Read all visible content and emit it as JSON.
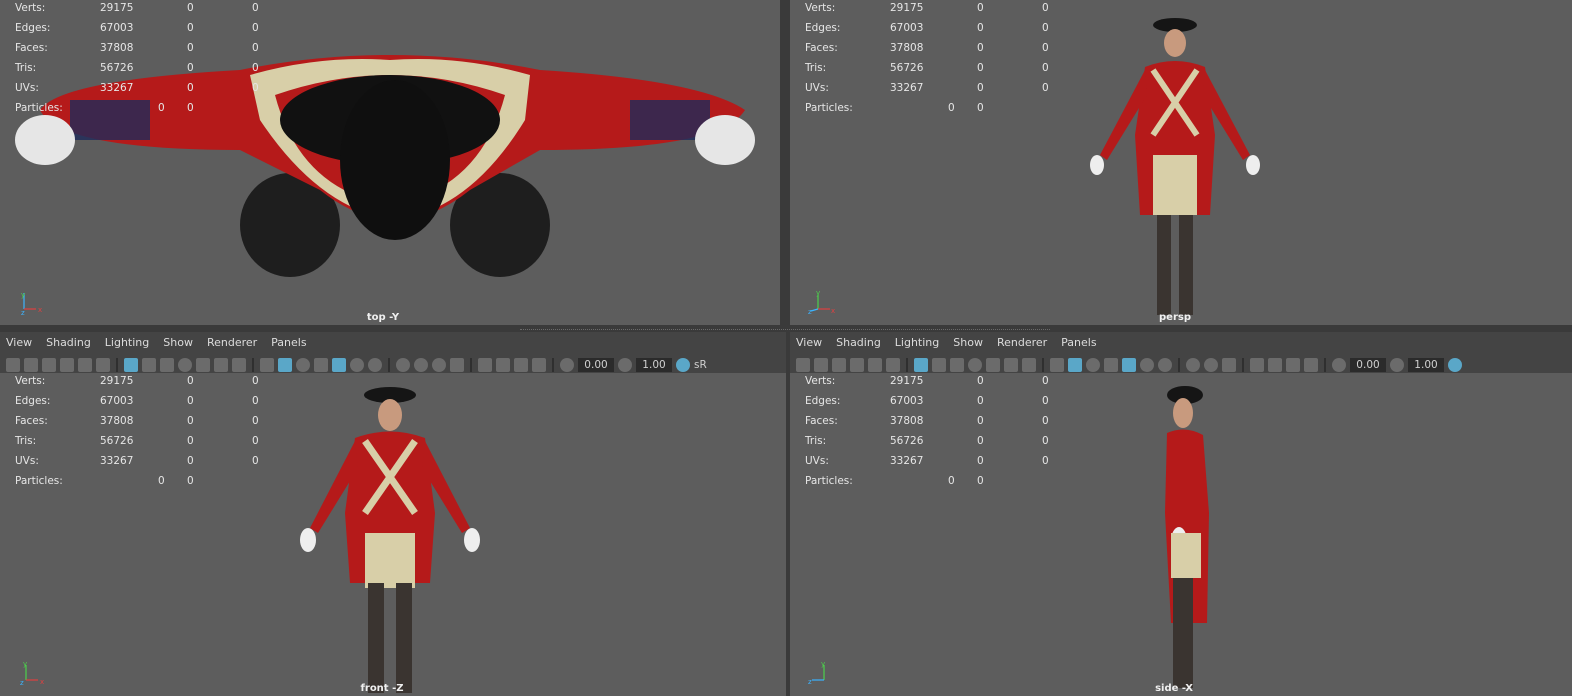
{
  "stats": [
    {
      "label": "Verts:",
      "a": "29175",
      "b": "0",
      "c": "0"
    },
    {
      "label": "Edges:",
      "a": "67003",
      "b": "0",
      "c": "0"
    },
    {
      "label": "Faces:",
      "a": "37808",
      "b": "0",
      "c": "0"
    },
    {
      "label": "Tris:",
      "a": "56726",
      "b": "0",
      "c": "0"
    },
    {
      "label": "UVs:",
      "a": "33267",
      "b": "0",
      "c": "0"
    }
  ],
  "particles": {
    "label": "Particles:",
    "a": "0",
    "b": "0"
  },
  "viewports": {
    "top": {
      "camera": "top -Y"
    },
    "persp": {
      "camera": "persp"
    },
    "front": {
      "camera": "front -Z"
    },
    "side": {
      "camera": "side -X"
    }
  },
  "menu": [
    "View",
    "Shading",
    "Lighting",
    "Show",
    "Renderer",
    "Panels"
  ],
  "toolbar": {
    "exposure": "0.00",
    "gamma": "1.00",
    "cm_label": "sR"
  },
  "axis": {
    "y": "y",
    "x": "x",
    "z": "z"
  },
  "colors": {
    "viewport_bg": "#5d5d5d",
    "highlight": "#5aa7c8",
    "coat_red": "#b51a1a",
    "breeches": "#d8cfa8"
  }
}
